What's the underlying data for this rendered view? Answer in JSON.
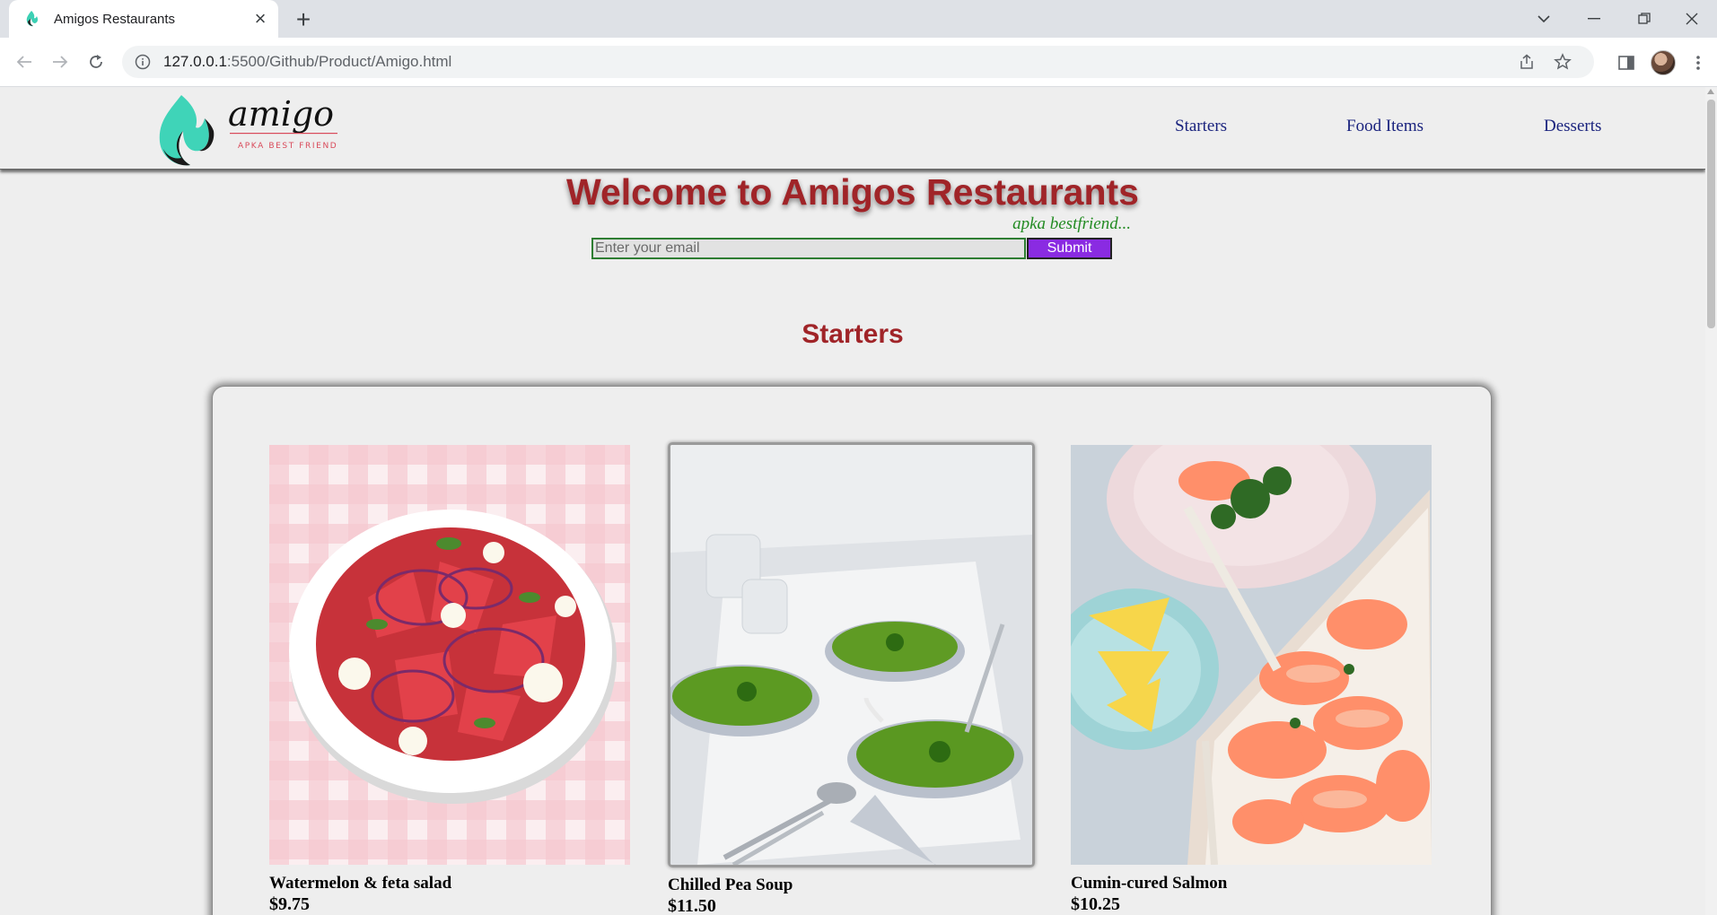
{
  "browser": {
    "tab_title": "Amigos Restaurants",
    "url_host": "127.0.0.1",
    "url_rest": ":5500/Github/Product/Amigo.html"
  },
  "navbar": {
    "logo_text": "amigo",
    "logo_tagline": "APKA BEST FRIEND",
    "links": [
      "Starters",
      "Food Items",
      "Desserts"
    ]
  },
  "hero": {
    "title": "Welcome to Amigos Restaurants",
    "tagline": "apka bestfriend...",
    "email_placeholder": "Enter your email",
    "submit_label": "Submit"
  },
  "starters": {
    "heading": "Starters",
    "items": [
      {
        "name": "Watermelon & feta salad",
        "price": "$9.75"
      },
      {
        "name": "Chilled Pea Soup",
        "price": "$11.50"
      },
      {
        "name": "Cumin-cured Salmon",
        "price": "$10.25"
      }
    ]
  },
  "colors": {
    "title_red": "#a02428",
    "nav_link": "#1a237e",
    "tagline_green": "#228b22",
    "submit_purple": "#8a2be2"
  }
}
